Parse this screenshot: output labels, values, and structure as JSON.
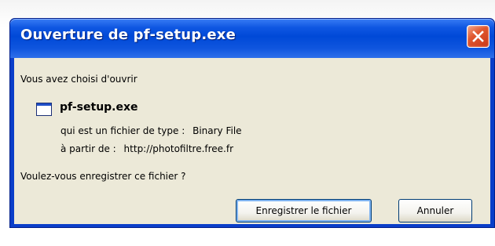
{
  "dialog": {
    "title": "Ouverture de pf-setup.exe",
    "close_icon": "close-icon",
    "intro": "Vous avez choisi d'ouvrir",
    "file": {
      "icon": "application-window-icon",
      "name": "pf-setup.exe",
      "type_label": "qui est un fichier de type :",
      "type_value": "Binary File",
      "source_label": "à partir de :",
      "source_value": "http://photofiltre.free.fr"
    },
    "question": "Voulez-vous enregistrer ce fichier ?",
    "buttons": {
      "save_label": "Enregistrer le fichier",
      "cancel_label": "Annuler"
    }
  }
}
